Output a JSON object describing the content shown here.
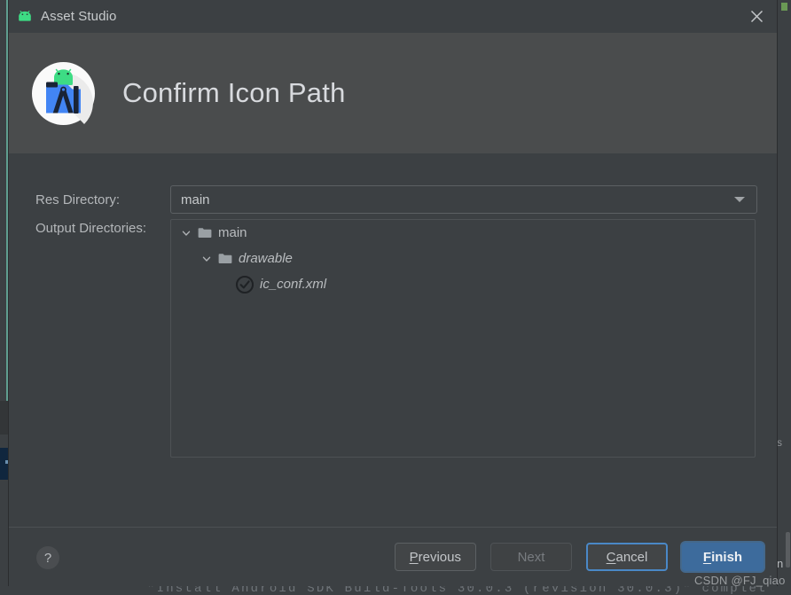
{
  "window": {
    "title": "Asset Studio",
    "title_icon": "android-robot-icon",
    "close_icon": "close-icon"
  },
  "header": {
    "icon": "asset-studio-icon",
    "title": "Confirm Icon Path"
  },
  "form": {
    "res_directory": {
      "label": "Res Directory:",
      "value": "main",
      "dropdown_icon": "chevron-down-icon"
    },
    "output_directories": {
      "label": "Output Directories:"
    }
  },
  "tree": {
    "nodes": [
      {
        "label": "main",
        "icon": "folder-icon",
        "chevron": "chevron-down-icon",
        "italic": false,
        "level": 0
      },
      {
        "label": "drawable",
        "icon": "folder-icon",
        "chevron": "chevron-down-icon",
        "italic": true,
        "level": 1
      },
      {
        "label": "ic_conf.xml",
        "icon": "check-circle-icon",
        "chevron": "",
        "italic": true,
        "level": 2
      }
    ]
  },
  "footer": {
    "help_label": "?",
    "help_icon": "question-mark-icon",
    "buttons": [
      {
        "name": "previous",
        "label_pre": "",
        "label_accel": "P",
        "label_post": "revious",
        "state": "enabled"
      },
      {
        "name": "next",
        "label_pre": "Next",
        "label_accel": "",
        "label_post": "",
        "state": "disabled"
      },
      {
        "name": "cancel",
        "label_pre": "",
        "label_accel": "C",
        "label_post": "ancel",
        "state": "focused"
      },
      {
        "name": "finish",
        "label_pre": "",
        "label_accel": "F",
        "label_post": "inish",
        "state": "primary"
      }
    ]
  },
  "background": {
    "console_text": "\"Install Android SDK Build-Tools 30.0.3 (revision 30.0.3)\" complet",
    "right_fragment": "s",
    "right_fragment2": "n"
  },
  "watermark": "CSDN @FJ_qiao",
  "colors": {
    "window_bg": "#3c4043",
    "header_bg": "#4a4c4d",
    "accent_blue": "#3d6b9c",
    "focus_blue": "#4a88c7",
    "text_primary": "#c7cacc",
    "text_muted": "#787c80",
    "android_green": "#3ddc84"
  }
}
